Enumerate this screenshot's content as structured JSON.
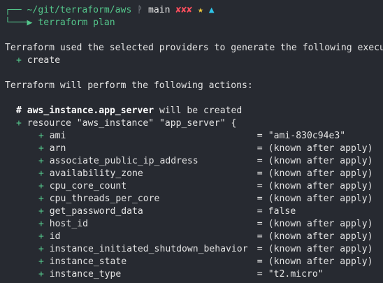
{
  "prompt": {
    "corner_top": "┌──",
    "path": "~/git/terraform/aws",
    "branch_icon": "ᚹ",
    "branch": "main",
    "dirty": "✘✘✘",
    "star": "★",
    "arrow": "▲",
    "corner_bottom": "└───▶",
    "command": "terraform plan"
  },
  "output": {
    "providers_line": "Terraform used the selected providers to generate the following execution plan. Resource actions are indicated with the following symbols:",
    "legend_symbol": "+",
    "legend_label": "create",
    "actions_line": "Terraform will perform the following actions:",
    "comment_hash": "#",
    "resource_address": "aws_instance.app_server",
    "comment_rest": " will be created",
    "resource_plus": "+",
    "resource_decl": "resource \"aws_instance\" \"app_server\" {",
    "attributes": [
      {
        "name": "ami",
        "value": "\"ami-830c94e3\""
      },
      {
        "name": "arn",
        "value": "(known after apply)"
      },
      {
        "name": "associate_public_ip_address",
        "value": "(known after apply)"
      },
      {
        "name": "availability_zone",
        "value": "(known after apply)"
      },
      {
        "name": "cpu_core_count",
        "value": "(known after apply)"
      },
      {
        "name": "cpu_threads_per_core",
        "value": "(known after apply)"
      },
      {
        "name": "get_password_data",
        "value": "false"
      },
      {
        "name": "host_id",
        "value": "(known after apply)"
      },
      {
        "name": "id",
        "value": "(known after apply)"
      },
      {
        "name": "instance_initiated_shutdown_behavior",
        "value": "(known after apply)"
      },
      {
        "name": "instance_state",
        "value": "(known after apply)"
      },
      {
        "name": "instance_type",
        "value": "\"t2.micro\""
      }
    ]
  },
  "colors": {
    "background": "#272a31",
    "prompt_green": "#54c68b",
    "dirty_red": "#ff4f5e",
    "star_yellow": "#f2cb3b",
    "arrow_cyan": "#2ec4e8"
  }
}
